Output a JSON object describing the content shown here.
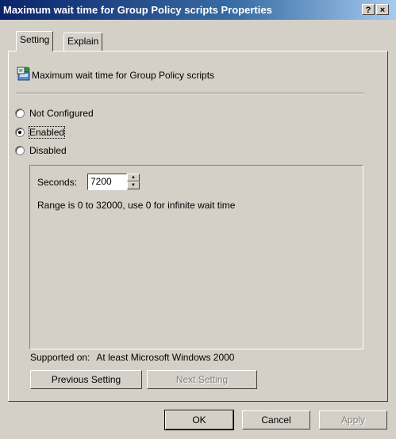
{
  "window": {
    "title": "Maximum wait time for Group Policy scripts Properties",
    "help_button": "?",
    "close_button": "×"
  },
  "tabs": [
    {
      "label": "Setting",
      "active": true
    },
    {
      "label": "Explain",
      "active": false
    }
  ],
  "policy": {
    "name": "Maximum wait time for Group Policy scripts",
    "icon": "policy-setting-icon"
  },
  "state_options": [
    {
      "label": "Not Configured",
      "accel": "C",
      "checked": false
    },
    {
      "label": "Enabled",
      "accel": "E",
      "checked": true
    },
    {
      "label": "Disabled",
      "accel": "D",
      "checked": false
    }
  ],
  "options": {
    "seconds_label": "Seconds:",
    "seconds_value": "7200",
    "range_text": "Range is 0 to 32000, use 0 for infinite wait time"
  },
  "supported": {
    "label": "Supported on:",
    "value": "At least Microsoft Windows 2000"
  },
  "nav": {
    "previous": "Previous Setting",
    "next": "Next Setting"
  },
  "footer": {
    "ok": "OK",
    "cancel": "Cancel",
    "apply": "Apply"
  }
}
